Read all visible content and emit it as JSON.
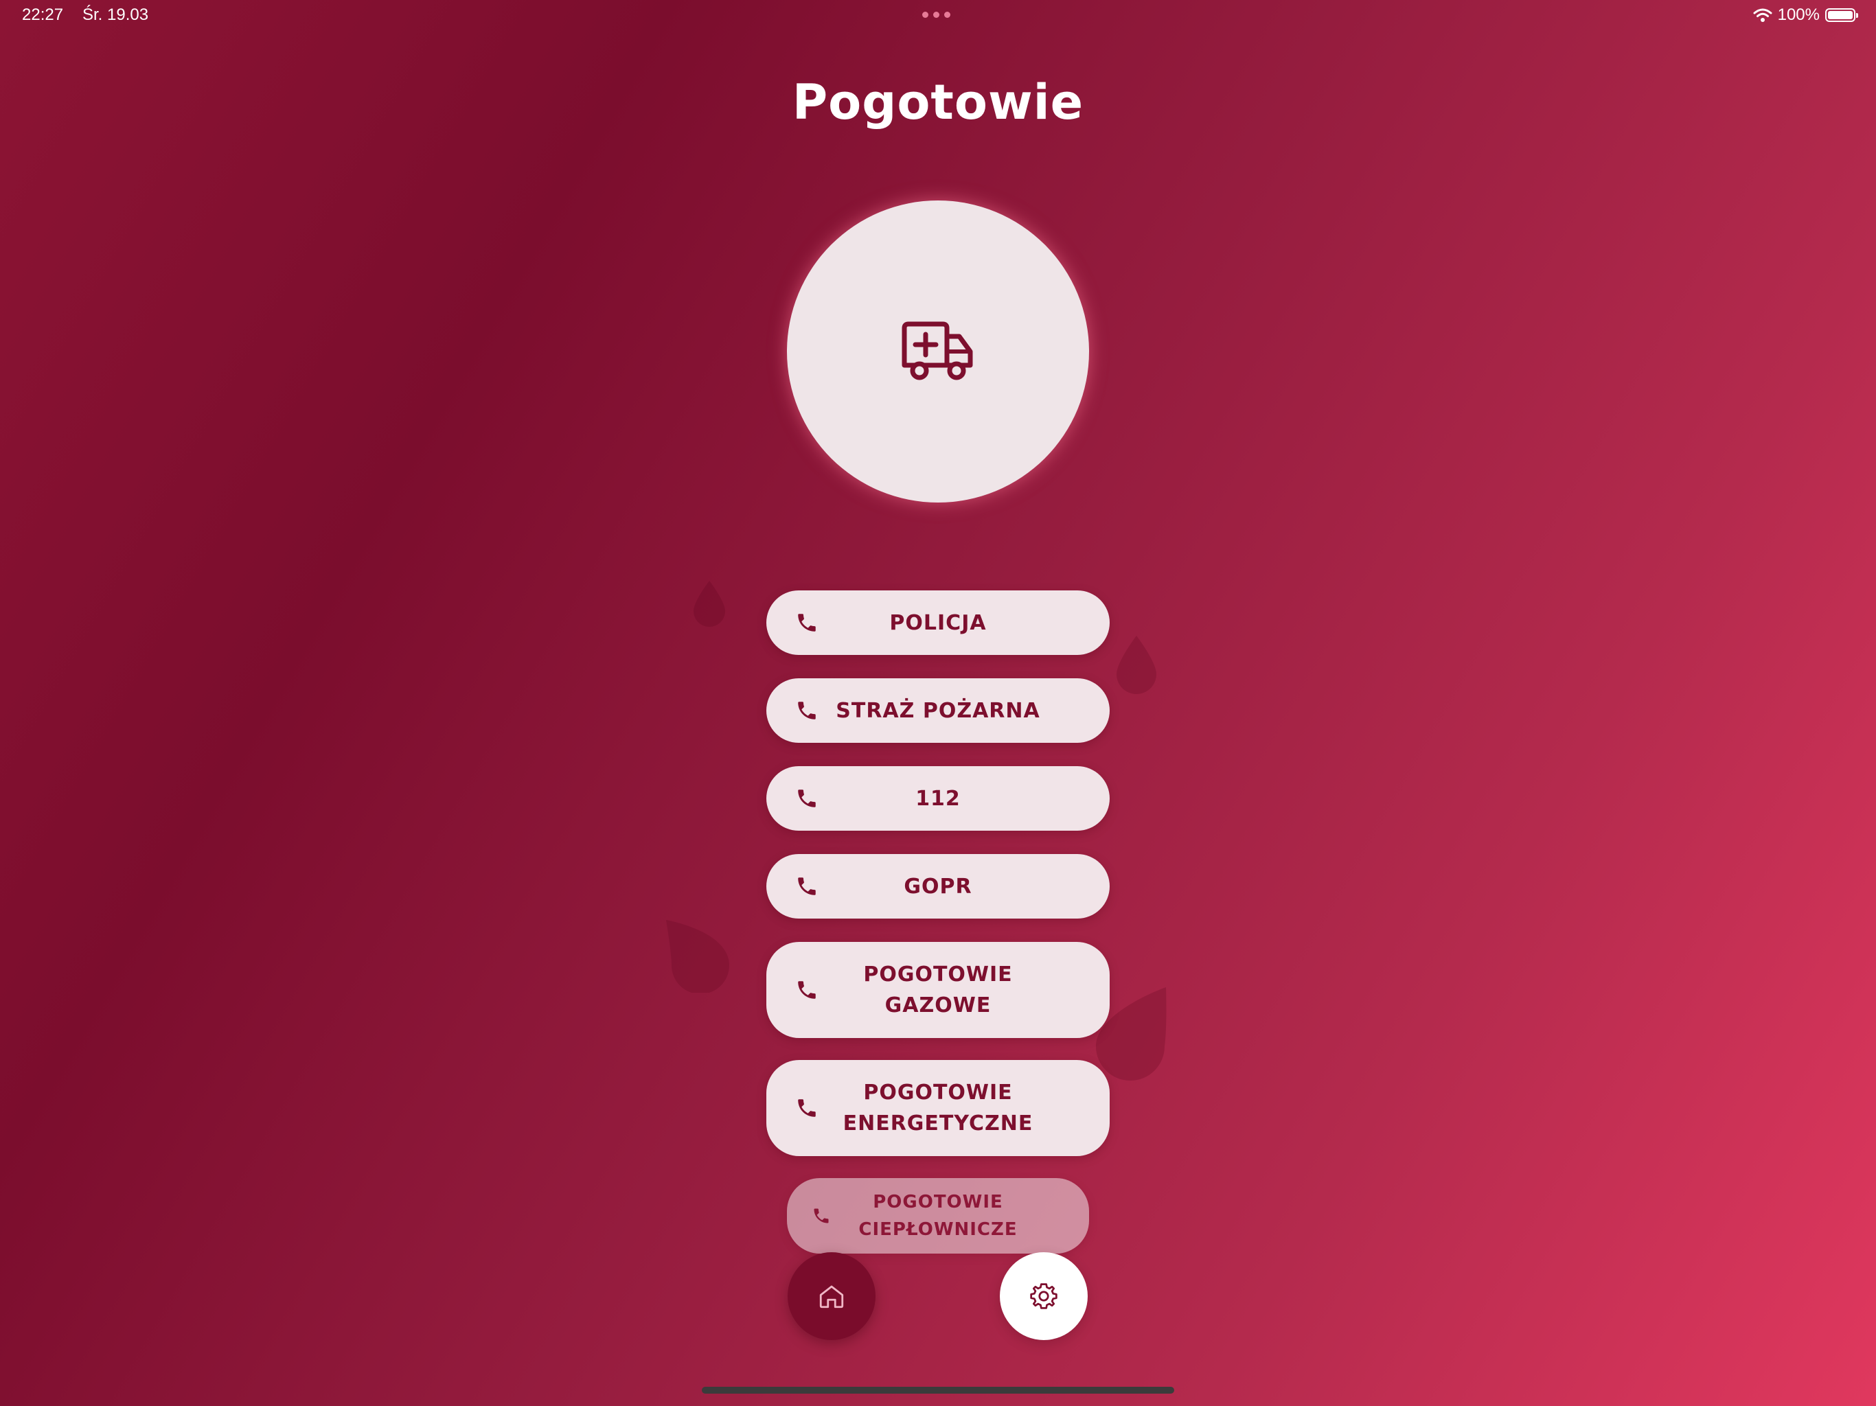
{
  "status_bar": {
    "time": "22:27",
    "date": "Śr. 19.03",
    "battery": "100%"
  },
  "header": {
    "title": "Pogotowie"
  },
  "hero": {
    "icon": "ambulance-icon"
  },
  "emergency_buttons": [
    {
      "label": "POLICJA",
      "icon": "phone-icon"
    },
    {
      "label": "STRAŻ POŻARNA",
      "icon": "phone-icon"
    },
    {
      "label": "112",
      "icon": "phone-icon"
    },
    {
      "label": "GOPR",
      "icon": "phone-icon"
    },
    {
      "label": "POGOTOWIE GAZOWE",
      "icon": "phone-icon"
    },
    {
      "label": "POGOTOWIE ENERGETYCZNE",
      "icon": "phone-icon"
    },
    {
      "label": "POGOTOWIE CIEPŁOWNICZE",
      "icon": "phone-icon"
    }
  ],
  "bottom_nav": {
    "home_icon": "home-icon",
    "settings_icon": "gear-icon"
  },
  "colors": {
    "accent": "#7d0f2e",
    "button_bg": "#f1e4e8",
    "hero_bg": "#efe5e8",
    "gradient_start": "#7b0d2d",
    "gradient_end": "#e0385e"
  }
}
